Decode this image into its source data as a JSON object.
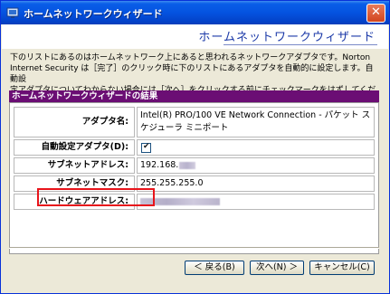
{
  "window": {
    "title": "ホームネットワークウィザード",
    "close_glyph": "✕"
  },
  "header": {
    "title": "ホームネットワークウィザード"
  },
  "description": [
    "下のリストにあるのはホームネットワーク上にあると思われるネットワークアダプタです。Norton",
    "Internet Security は［完了］のクリック時に下のリストにあるアダプタを自動的に設定します。自動設",
    "定アダプタについてわからない場合には［次へ］をクリックする前にチェックマークをはずしてください。"
  ],
  "section": {
    "title": "ホームネットワークウィザードの結果"
  },
  "rows": {
    "adapter_name": {
      "label": "アダプタ名:",
      "value_line1": "Intel(R) PRO/100 VE Network Connection - パケット ス",
      "value_line2": "ケジューラ ミニポート"
    },
    "auto_config": {
      "label": "自動設定アダプタ(D):",
      "checked": true,
      "check_glyph": "✔"
    },
    "subnet_address": {
      "label": "サブネットアドレス:",
      "value_prefix": "192.168."
    },
    "subnet_mask": {
      "label": "サブネットマスク:",
      "value": "255.255.255.0"
    },
    "hardware_address": {
      "label": "ハードウェアアドレス:"
    }
  },
  "buttons": {
    "back": "＜ 戻る(B)",
    "next": "次へ(N) ＞",
    "cancel": "キャンセル(C)"
  },
  "colors": {
    "accent": "#6b0e74",
    "header_text": "#1c3aa8",
    "highlight": "#e8141b",
    "titlebar": "#0453e0"
  }
}
